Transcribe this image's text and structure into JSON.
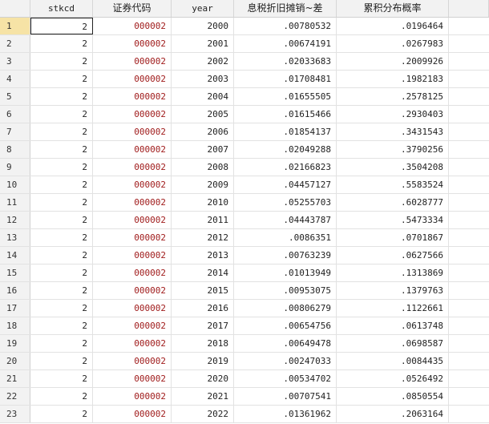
{
  "columns": [
    "stkcd",
    "证券代码",
    "year",
    "息税折旧摊销~差",
    "累积分布概率"
  ],
  "selected_row": 1,
  "colors": {
    "string_value": "#a01c1c",
    "selected_row_header": "#f6e3a6"
  },
  "rows": [
    {
      "n": "1",
      "stkcd": "2",
      "code": "000002",
      "year": "2000",
      "diff": ".00780532",
      "cdf": ".0196464"
    },
    {
      "n": "2",
      "stkcd": "2",
      "code": "000002",
      "year": "2001",
      "diff": ".00674191",
      "cdf": ".0267983"
    },
    {
      "n": "3",
      "stkcd": "2",
      "code": "000002",
      "year": "2002",
      "diff": ".02033683",
      "cdf": ".2009926"
    },
    {
      "n": "4",
      "stkcd": "2",
      "code": "000002",
      "year": "2003",
      "diff": ".01708481",
      "cdf": ".1982183"
    },
    {
      "n": "5",
      "stkcd": "2",
      "code": "000002",
      "year": "2004",
      "diff": ".01655505",
      "cdf": ".2578125"
    },
    {
      "n": "6",
      "stkcd": "2",
      "code": "000002",
      "year": "2005",
      "diff": ".01615466",
      "cdf": ".2930403"
    },
    {
      "n": "7",
      "stkcd": "2",
      "code": "000002",
      "year": "2006",
      "diff": ".01854137",
      "cdf": ".3431543"
    },
    {
      "n": "8",
      "stkcd": "2",
      "code": "000002",
      "year": "2007",
      "diff": ".02049288",
      "cdf": ".3790256"
    },
    {
      "n": "9",
      "stkcd": "2",
      "code": "000002",
      "year": "2008",
      "diff": ".02166823",
      "cdf": ".3504208"
    },
    {
      "n": "10",
      "stkcd": "2",
      "code": "000002",
      "year": "2009",
      "diff": ".04457127",
      "cdf": ".5583524"
    },
    {
      "n": "11",
      "stkcd": "2",
      "code": "000002",
      "year": "2010",
      "diff": ".05255703",
      "cdf": ".6028777"
    },
    {
      "n": "12",
      "stkcd": "2",
      "code": "000002",
      "year": "2011",
      "diff": ".04443787",
      "cdf": ".5473334"
    },
    {
      "n": "13",
      "stkcd": "2",
      "code": "000002",
      "year": "2012",
      "diff": ".0086351",
      "cdf": ".0701867"
    },
    {
      "n": "14",
      "stkcd": "2",
      "code": "000002",
      "year": "2013",
      "diff": ".00763239",
      "cdf": ".0627566"
    },
    {
      "n": "15",
      "stkcd": "2",
      "code": "000002",
      "year": "2014",
      "diff": ".01013949",
      "cdf": ".1313869"
    },
    {
      "n": "16",
      "stkcd": "2",
      "code": "000002",
      "year": "2015",
      "diff": ".00953075",
      "cdf": ".1379763"
    },
    {
      "n": "17",
      "stkcd": "2",
      "code": "000002",
      "year": "2016",
      "diff": ".00806279",
      "cdf": ".1122661"
    },
    {
      "n": "18",
      "stkcd": "2",
      "code": "000002",
      "year": "2017",
      "diff": ".00654756",
      "cdf": ".0613748"
    },
    {
      "n": "19",
      "stkcd": "2",
      "code": "000002",
      "year": "2018",
      "diff": ".00649478",
      "cdf": ".0698587"
    },
    {
      "n": "20",
      "stkcd": "2",
      "code": "000002",
      "year": "2019",
      "diff": ".00247033",
      "cdf": ".0084435"
    },
    {
      "n": "21",
      "stkcd": "2",
      "code": "000002",
      "year": "2020",
      "diff": ".00534702",
      "cdf": ".0526492"
    },
    {
      "n": "22",
      "stkcd": "2",
      "code": "000002",
      "year": "2021",
      "diff": ".00707541",
      "cdf": ".0850554"
    },
    {
      "n": "23",
      "stkcd": "2",
      "code": "000002",
      "year": "2022",
      "diff": ".01361962",
      "cdf": ".2063164"
    }
  ]
}
